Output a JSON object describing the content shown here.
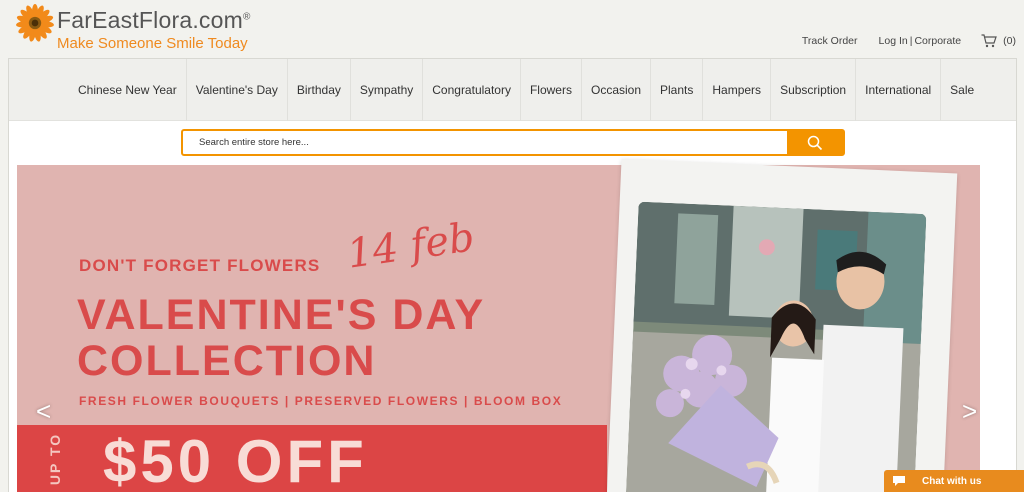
{
  "header": {
    "logo_name": "FarEastFlora.com",
    "logo_reg": "®",
    "tagline": "Make Someone Smile Today",
    "track_order": "Track Order",
    "login": "Log In",
    "separator": "|",
    "corporate": "Corporate",
    "cart_count": "(0)"
  },
  "nav": {
    "items": [
      "Chinese New Year",
      "Valentine's Day",
      "Birthday",
      "Sympathy",
      "Congratulatory",
      "Flowers",
      "Occasion",
      "Plants",
      "Hampers",
      "Subscription",
      "International",
      "Sale"
    ]
  },
  "search": {
    "placeholder": "Search entire store here..."
  },
  "banner": {
    "kicker": "DON'T FORGET FLOWERS",
    "script_date": "14 feb",
    "headline_line1": "VALENTINE'S DAY",
    "headline_line2": "COLLECTION",
    "subline": "FRESH FLOWER BOUQUETS | PRESERVED FLOWERS | BLOOM BOX",
    "up_to": "UP TO",
    "offer": "$50 OFF",
    "prev_arrow": "<",
    "next_arrow": ">"
  },
  "chat": {
    "label": "Chat with us"
  },
  "colors": {
    "brand_orange": "#f39400",
    "banner_pink": "#e0b4b0",
    "banner_red": "#d94b4b"
  }
}
